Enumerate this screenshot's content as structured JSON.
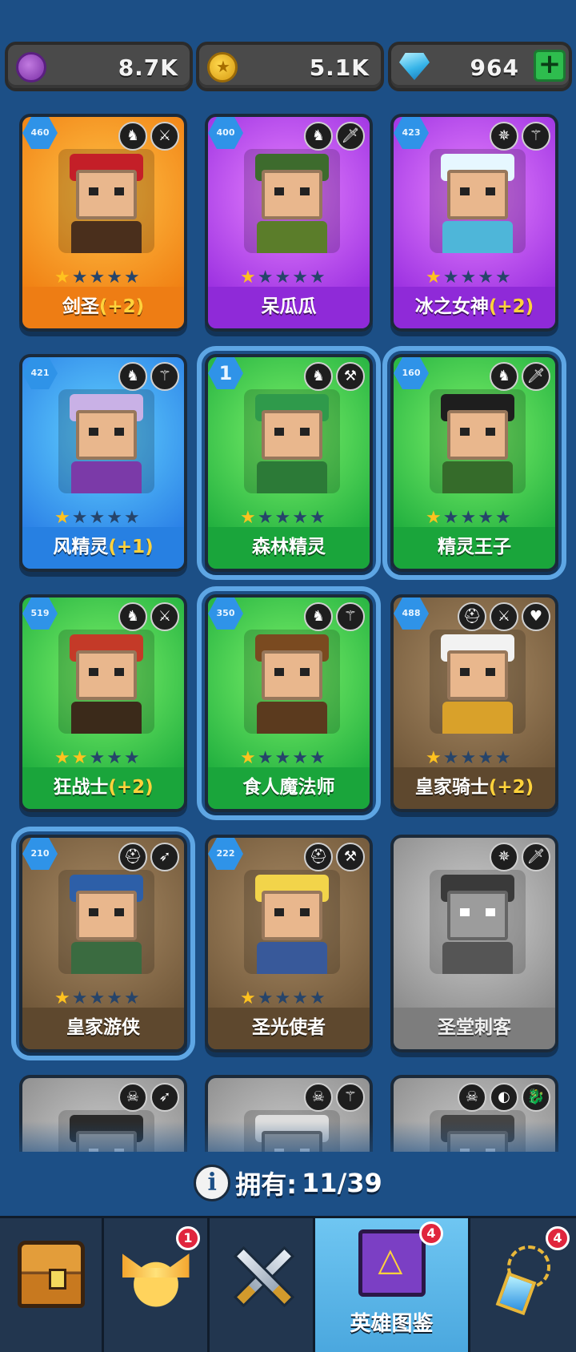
{
  "currencies": {
    "purple": {
      "amount": "8.7K",
      "icon": "purple-coin-icon"
    },
    "gold": {
      "amount": "5.1K",
      "icon": "gold-coin-icon"
    },
    "gems": {
      "amount": "964",
      "icon": "diamond-icon",
      "plus": "+"
    }
  },
  "heroes": [
    {
      "name": "剑圣",
      "bonus": "(+2)",
      "level": "460",
      "stars": 1,
      "bg": "orange",
      "icons": [
        "♞",
        "⚔"
      ],
      "hair": "#c41f28",
      "body": "#4a2f1c"
    },
    {
      "name": "呆瓜瓜",
      "bonus": "",
      "level": "400",
      "stars": 1,
      "bg": "purple",
      "icons": [
        "♞",
        "🗡"
      ],
      "hair": "#3d6b2d",
      "body": "#5b7d2a"
    },
    {
      "name": "冰之女神",
      "bonus": "(+2)",
      "level": "423",
      "stars": 1,
      "bg": "purple",
      "icons": [
        "✵",
        "⚚"
      ],
      "hair": "#e6f7ff",
      "body": "#4eb6d9"
    },
    {
      "name": "风精灵",
      "bonus": "(+1)",
      "level": "421",
      "stars": 1,
      "bg": "blue",
      "icons": [
        "♞",
        "⚚"
      ],
      "hair": "#c9b1e6",
      "body": "#7b3aa8"
    },
    {
      "name": "森林精灵",
      "bonus": "",
      "level": "1",
      "stars": 1,
      "bg": "green",
      "icons": [
        "♞",
        "⚒"
      ],
      "hair": "#2f9a4b",
      "body": "#2c7a37"
    },
    {
      "name": "精灵王子",
      "bonus": "",
      "level": "160",
      "stars": 1,
      "bg": "green",
      "icons": [
        "♞",
        "🗡"
      ],
      "hair": "#1e1e1e",
      "body": "#356b2a"
    },
    {
      "name": "狂战士",
      "bonus": "(+2)",
      "level": "519",
      "stars": 2,
      "bg": "green",
      "icons": [
        "♞",
        "⚔"
      ],
      "hair": "#c43a28",
      "body": "#3b2a1a"
    },
    {
      "name": "食人魔法师",
      "bonus": "",
      "level": "350",
      "stars": 1,
      "bg": "green",
      "icons": [
        "♞",
        "⚚"
      ],
      "hair": "#7a4a20",
      "body": "#5b3a1e"
    },
    {
      "name": "皇家骑士",
      "bonus": "(+2)",
      "level": "488",
      "stars": 1,
      "bg": "brown",
      "icons": [
        "⛑",
        "⚔",
        "♥"
      ],
      "hair": "#f2f2f2",
      "body": "#d9a12a"
    },
    {
      "name": "皇家游侠",
      "bonus": "",
      "level": "210",
      "stars": 1,
      "bg": "brown",
      "icons": [
        "⛑",
        "➶"
      ],
      "hair": "#2d5fa8",
      "body": "#3a6b40"
    },
    {
      "name": "圣光使者",
      "bonus": "",
      "level": "222",
      "stars": 1,
      "bg": "brown",
      "icons": [
        "⛑",
        "⚒"
      ],
      "hair": "#f2d44a",
      "body": "#38599a"
    },
    {
      "name": "圣堂刺客",
      "bonus": "",
      "level": "",
      "stars": 0,
      "bg": "gray",
      "icons": [
        "✵",
        "🗡"
      ],
      "hair": "#3a3a3a",
      "body": "#555555"
    },
    {
      "name": "",
      "bonus": "",
      "level": "",
      "stars": 0,
      "bg": "gray",
      "icons": [
        "☠",
        "➶"
      ],
      "hair": "#2a2a2a",
      "body": "#555555"
    },
    {
      "name": "",
      "bonus": "",
      "level": "",
      "stars": 0,
      "bg": "gray",
      "icons": [
        "☠",
        "⚚"
      ],
      "hair": "#dddddd",
      "body": "#555555"
    },
    {
      "name": "",
      "bonus": "",
      "level": "",
      "stars": 0,
      "bg": "gray",
      "icons": [
        "☠",
        "◐",
        "🐉"
      ],
      "hair": "#444444",
      "body": "#555555"
    }
  ],
  "owned": {
    "label": "拥有:",
    "value": "11/39",
    "icon": "info-icon"
  },
  "nav": [
    {
      "id": "shop",
      "icon": "treasure-chest-icon",
      "label": "",
      "badge": ""
    },
    {
      "id": "hero",
      "icon": "winged-helmet-icon",
      "label": "",
      "badge": "1"
    },
    {
      "id": "battle",
      "icon": "crossed-swords-icon",
      "label": "",
      "badge": ""
    },
    {
      "id": "codex",
      "icon": "hero-book-icon",
      "label": "英雄图鉴",
      "badge": "4"
    },
    {
      "id": "items",
      "icon": "amulet-icon",
      "label": "",
      "badge": "4"
    }
  ],
  "colors": {
    "background": "#1c4f86",
    "nav_active": "#5fb8ea",
    "star_on": "#ffc21f",
    "bonus": "#ffd23b"
  }
}
